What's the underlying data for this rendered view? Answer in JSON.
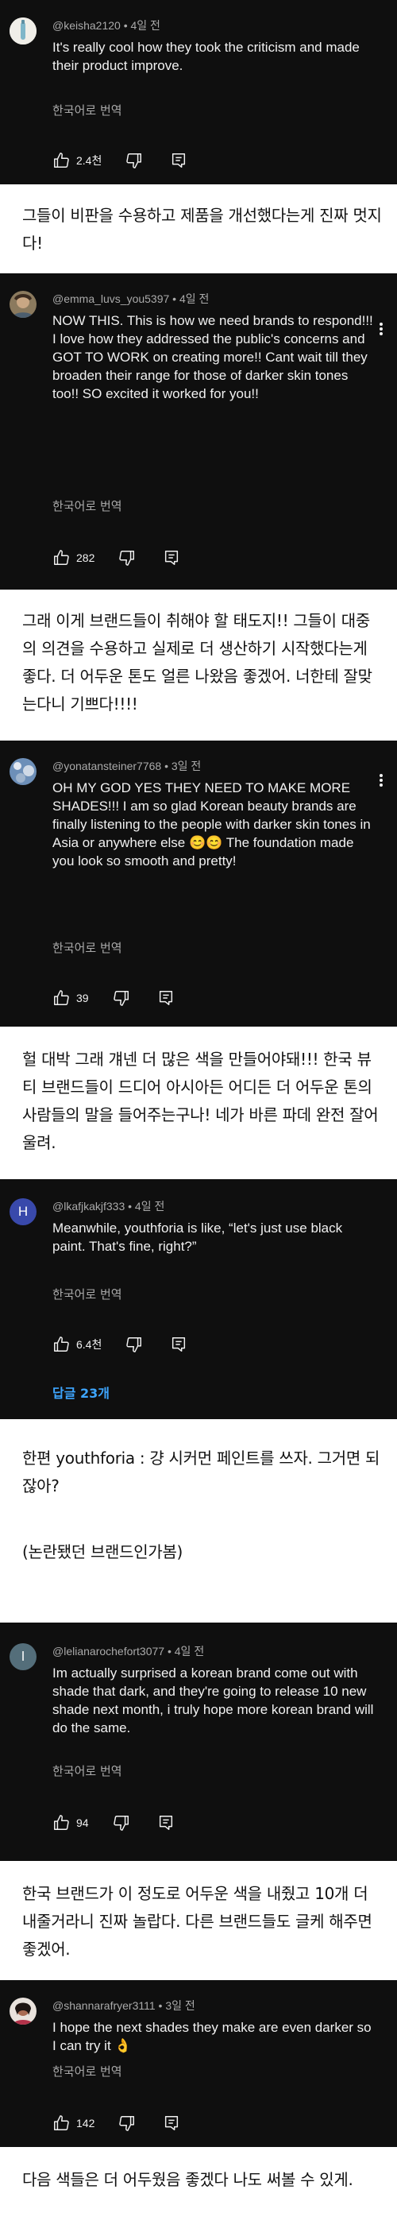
{
  "comments": [
    {
      "meta": "@keisha2120 • 4일 전",
      "text": "It's really cool how they took the criticism and made their product improve.",
      "translate": "한국어로 번역",
      "likes": "2.4천",
      "avatar": "keisha-avatar"
    },
    {
      "meta": "@emma_luvs_you5397 • 4일 전",
      "text": "NOW THIS. This is how we need brands to respond!!! I love how they addressed the public's concerns and GOT TO WORK on creating more!! Cant wait till they broaden their range for those of darker skin tones too!! SO excited it worked for you!!",
      "translate": "한국어로 번역",
      "likes": "282",
      "avatar": "emma-avatar"
    },
    {
      "meta": "@yonatansteiner7768 • 3일 전",
      "text": "OH MY GOD YES THEY NEED TO MAKE MORE SHADES!!! I am so glad Korean beauty brands are finally listening to the people with darker skin tones in Asia or anywhere else 😊😊 The foundation made you look so smooth and pretty!",
      "translate": "한국어로 번역",
      "likes": "39",
      "avatar": "yonatan-avatar"
    },
    {
      "meta": "@lkafjkakjf333 • 4일 전",
      "text": "Meanwhile, youthforia is like, “let's just use black paint.  That's fine, right?”",
      "translate": "한국어로 번역",
      "likes": "6.4천",
      "replies": "답글 23개",
      "avatar_letter": "H",
      "avatar": "letter-avatar"
    },
    {
      "meta": "@lelianarochefort3077 • 4일 전",
      "text": "Im actually surprised a korean brand come out with shade that dark, and they're going to release 10 new shade next month, i truly hope more korean brand will do the same.",
      "translate": "한국어로 번역",
      "likes": "94",
      "avatar_letter": "l",
      "avatar": "letter-avatar"
    },
    {
      "meta": "@shannarafryer3111 • 3일 전",
      "text": "I hope the next shades they make are even darker so I can try it 👌",
      "translate": "한국어로 번역",
      "likes": "142",
      "avatar": "shannara-avatar"
    }
  ],
  "translations": [
    "그들이 비판을 수용하고 제품을 개선했다는게 진짜 멋지다!",
    "그래 이게 브랜드들이 취해야 할 태도지!! 그들이 대중의 의견을 수용하고 실제로 더 생산하기 시작했다는게 좋다. 더 어두운 톤도 얼른 나왔음 좋겠어. 너한테 잘맞는다니 기쁘다!!!!",
    "헐 대박 그래 걔넨 더 많은 색을 만들어야돼!!! 한국 뷰티 브랜드들이 드디어 아시아든 어디든 더 어두운 톤의 사람들의 말을 들어주는구나! 네가 바른 파데 완전 잘어울려.",
    "한편 youthforia : 걍 시커먼 페인트를 쓰자. 그거면 되잖아?",
    "(논란됐던 브랜드인가봄)",
    "한국 브랜드가 이 정도로 어두운 색을 내줬고 10개 더 내줄거라니 진짜 놀랍다. 다른 브랜드들도 글케 해주면 좋겠어.",
    "다음 색들은 더 어두웠음 좋겠다 나도 써볼 수 있게."
  ],
  "colors": {
    "dark_bg": "#0f0f0f",
    "text_primary": "#f1f1f1",
    "text_secondary": "#aaaaaa",
    "link_blue": "#3ea6ff",
    "page_bg": "#ffffff"
  }
}
